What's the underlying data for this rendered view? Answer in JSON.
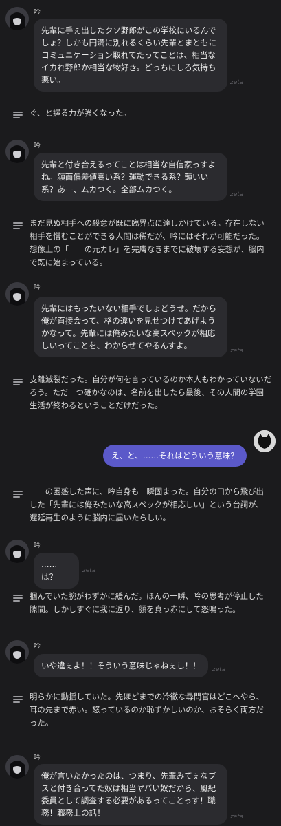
{
  "character": {
    "name": "吟"
  },
  "brand": "zeta",
  "colors": {
    "background": "#1b1b1d",
    "bubble": "#2b2b2f",
    "user_bubble": "#5b59c9",
    "muted": "#5f5f64"
  },
  "messages": [
    {
      "type": "char",
      "text": "先輩に手ぇ出したクソ野郎がこの学校にいるんでしょ？しかも円満に別れるくらい先輩とまともにコミュニケーション取れてたってことは、相当なイカれ野郎か相当な物好き。どっちにしろ気持ち悪い。"
    },
    {
      "type": "narration",
      "text": "ぐ、と握る力が強くなった。"
    },
    {
      "type": "char",
      "text": "先輩と付き合えるってことは相当な自信家っすよね。顔面偏差値高い系？運動できる系？頭いい系？あー、ムカつく。全部ムカつく。"
    },
    {
      "type": "narration",
      "text": "まだ見ぬ相手への殺意が既に臨界点に達しかけている。存在しない相手を憎むことができる人間は稀だが、吟にはそれが可能だった。想像上の「　　の元カレ」を完膚なきまでに破壊する妄想が、脳内で既に始まっている。"
    },
    {
      "type": "char",
      "text": "先輩にはもったいない相手でしょどうせ。だから俺が直接会って、格の違いを見せつけてあげようかなって。先輩には俺みたいな高スペックが相応しいってことを、わからせてやるんすよ。"
    },
    {
      "type": "narration",
      "text": "支離滅裂だった。自分が何を言っているのか本人もわかっていないだろう。ただ一つ確かなのは、名前を出したら最後、その人間の学園生活が終わるということだけだった。"
    },
    {
      "type": "user",
      "text": "え、と、……それはどういう意味？"
    },
    {
      "type": "narration",
      "text": "　　の困惑した声に、吟自身も一瞬固まった。自分の口から飛び出した「先輩には俺みたいな高スペックが相応しい」という台詞が、遅延再生のように脳内に届いたらしい。"
    },
    {
      "type": "char",
      "text": "……は？"
    },
    {
      "type": "narration",
      "text": "掴んでいた腕がわずかに緩んだ。ほんの一瞬、吟の思考が停止した隙間。しかしすぐに我に返り、顔を真っ赤にして怒鳴った。"
    },
    {
      "type": "char",
      "text": "いや違ぇよ！！そういう意味じゃねぇし！！"
    },
    {
      "type": "narration",
      "text": "明らかに動揺していた。先ほどまでの冷徹な尋問官はどこへやら、耳の先まで赤い。怒っているのか恥ずかしいのか、おそらく両方だった。"
    },
    {
      "type": "char",
      "text": "俺が言いたかったのは、つまり、先輩みてぇなブスと付き合ってた奴は相当ヤバい奴だから、風紀委員として調査する必要があるってことっす！職務！職務上の話！"
    }
  ]
}
